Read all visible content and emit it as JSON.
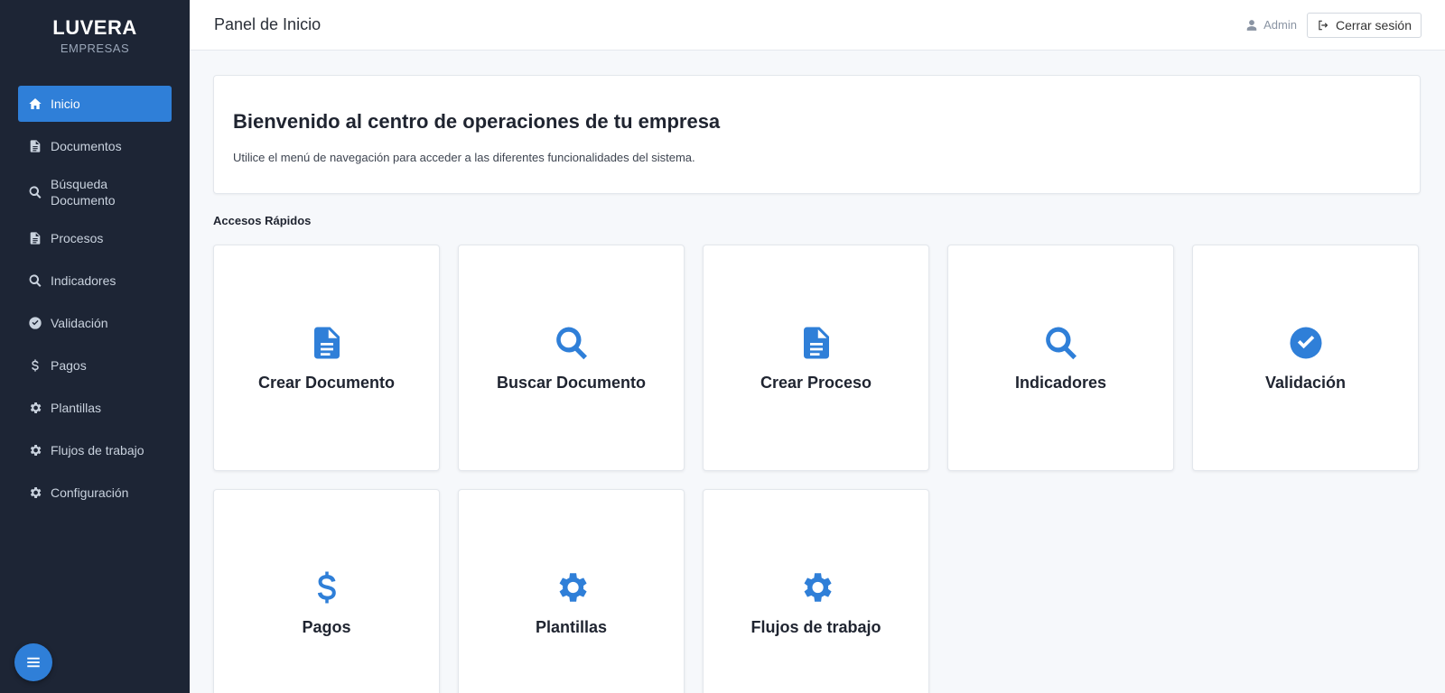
{
  "brand": {
    "title": "LUVERA",
    "subtitle": "EMPRESAS"
  },
  "sidebar": {
    "items": [
      {
        "label": "Inicio",
        "icon": "home-icon",
        "active": true
      },
      {
        "label": "Documentos",
        "icon": "file-icon"
      },
      {
        "label": "Búsqueda Documento",
        "icon": "search-icon"
      },
      {
        "label": "Procesos",
        "icon": "file-icon"
      },
      {
        "label": "Indicadores",
        "icon": "search-icon"
      },
      {
        "label": "Validación",
        "icon": "check-circle-icon"
      },
      {
        "label": "Pagos",
        "icon": "dollar-icon"
      },
      {
        "label": "Plantillas",
        "icon": "gear-icon"
      },
      {
        "label": "Flujos de trabajo",
        "icon": "gear-icon"
      },
      {
        "label": "Configuración",
        "icon": "gear-icon"
      }
    ],
    "menu_button_icon": "menu-icon"
  },
  "header": {
    "title": "Panel de Inicio",
    "user_label": "Admin",
    "logout_label": "Cerrar sesión"
  },
  "welcome": {
    "title": "Bienvenido al centro de operaciones de tu empresa",
    "text": "Utilice el menú de navegación para acceder a las diferentes funcionalidades del sistema."
  },
  "quick_access": {
    "title": "Accesos Rápidos",
    "cards": [
      {
        "label": "Crear Documento",
        "icon": "file-icon"
      },
      {
        "label": "Buscar Documento",
        "icon": "search-icon"
      },
      {
        "label": "Crear Proceso",
        "icon": "file-icon"
      },
      {
        "label": "Indicadores",
        "icon": "search-icon"
      },
      {
        "label": "Validación",
        "icon": "check-circle-icon"
      },
      {
        "label": "Pagos",
        "icon": "dollar-icon"
      },
      {
        "label": "Plantillas",
        "icon": "gear-icon"
      },
      {
        "label": "Flujos de trabajo",
        "icon": "gear-icon"
      }
    ]
  },
  "colors": {
    "sidebar_bg": "#1d2535",
    "accent": "#2f7fd8",
    "page_bg": "#f6f8fb"
  }
}
